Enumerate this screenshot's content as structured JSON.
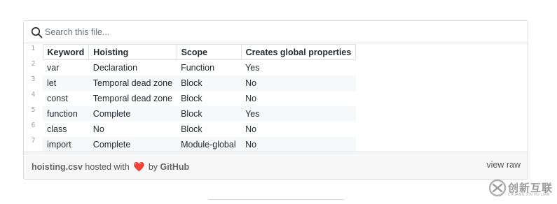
{
  "search": {
    "placeholder": "Search this file..."
  },
  "table": {
    "header_line": "1",
    "headers": [
      "Keyword",
      "Hoisting",
      "Scope",
      "Creates global properties"
    ],
    "rows": [
      {
        "line": "2",
        "cells": [
          "var",
          "Declaration",
          "Function",
          "Yes"
        ]
      },
      {
        "line": "3",
        "cells": [
          "let",
          "Temporal dead zone",
          "Block",
          "No"
        ]
      },
      {
        "line": "4",
        "cells": [
          "const",
          "Temporal dead zone",
          "Block",
          "No"
        ]
      },
      {
        "line": "5",
        "cells": [
          "function",
          "Complete",
          "Block",
          "Yes"
        ]
      },
      {
        "line": "6",
        "cells": [
          "class",
          "No",
          "Block",
          "No"
        ]
      },
      {
        "line": "7",
        "cells": [
          "import",
          "Complete",
          "Module-global",
          "No"
        ]
      }
    ]
  },
  "footer": {
    "filename": "hoisting.csv",
    "hosted_with": "hosted with",
    "heart": "❤️",
    "by": "by",
    "brand": "GitHub",
    "view_raw": "view raw"
  },
  "watermark": {
    "text": "创新互联",
    "sub": "CHUANG XIN HU LIAN"
  },
  "colors": {
    "border": "#dddddd",
    "stripe": "#f6f8fa",
    "footer_bg": "#f7f7f7",
    "heart": "#e0245e"
  }
}
